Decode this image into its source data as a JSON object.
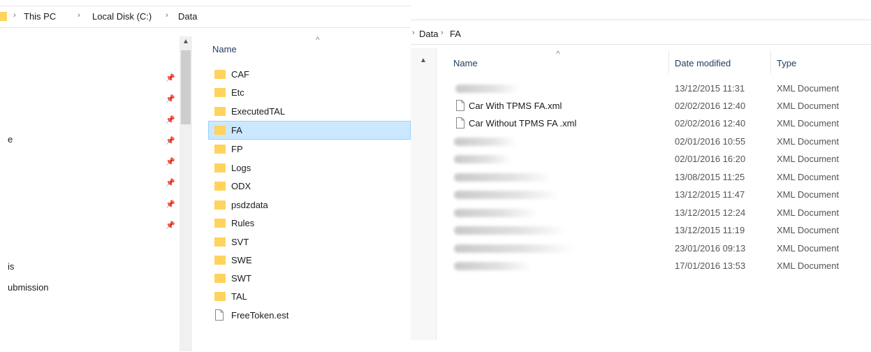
{
  "left_window": {
    "breadcrumb": [
      "This PC",
      "Local Disk (C:)",
      "Data"
    ],
    "nav_fragments": [
      "e",
      "is",
      "ubmission"
    ],
    "column_header": "Name",
    "items": [
      {
        "name": "CAF",
        "type": "folder"
      },
      {
        "name": "Etc",
        "type": "folder"
      },
      {
        "name": "ExecutedTAL",
        "type": "folder"
      },
      {
        "name": "FA",
        "type": "folder",
        "selected": true
      },
      {
        "name": "FP",
        "type": "folder"
      },
      {
        "name": "Logs",
        "type": "folder"
      },
      {
        "name": "ODX",
        "type": "folder"
      },
      {
        "name": "psdzdata",
        "type": "folder"
      },
      {
        "name": "Rules",
        "type": "folder"
      },
      {
        "name": "SVT",
        "type": "folder"
      },
      {
        "name": "SWE",
        "type": "folder"
      },
      {
        "name": "SWT",
        "type": "folder"
      },
      {
        "name": "TAL",
        "type": "folder"
      },
      {
        "name": "FreeToken.est",
        "type": "file"
      }
    ]
  },
  "right_window": {
    "breadcrumb": [
      "Data",
      "FA"
    ],
    "columns": {
      "name": "Name",
      "date": "Date modified",
      "type": "Type"
    },
    "rows": [
      {
        "name": "",
        "blurred": true,
        "date": "13/12/2015 11:31",
        "type": "XML Document"
      },
      {
        "name": "Car With TPMS FA.xml",
        "blurred": false,
        "date": "02/02/2016 12:40",
        "type": "XML Document"
      },
      {
        "name": "Car Without TPMS FA .xml",
        "blurred": false,
        "date": "02/02/2016 12:40",
        "type": "XML Document"
      },
      {
        "name": "",
        "blurred": true,
        "date": "02/01/2016 10:55",
        "type": "XML Document"
      },
      {
        "name": "",
        "blurred": true,
        "date": "02/01/2016 16:20",
        "type": "XML Document"
      },
      {
        "name": "",
        "blurred": true,
        "date": "13/08/2015 11:25",
        "type": "XML Document"
      },
      {
        "name": "",
        "blurred": true,
        "date": "13/12/2015 11:47",
        "type": "XML Document"
      },
      {
        "name": "",
        "blurred": true,
        "date": "13/12/2015 12:24",
        "type": "XML Document"
      },
      {
        "name": "",
        "blurred": true,
        "date": "13/12/2015 11:19",
        "type": "XML Document"
      },
      {
        "name": "",
        "blurred": true,
        "date": "23/01/2016 09:13",
        "type": "XML Document"
      },
      {
        "name": "",
        "blurred": true,
        "date": "17/01/2016 13:53",
        "type": "XML Document"
      }
    ]
  },
  "colors": {
    "selection": "#cce8ff",
    "selection_border": "#99d1ff",
    "folder": "#ffd35c",
    "header_text": "#1e3a5f"
  }
}
